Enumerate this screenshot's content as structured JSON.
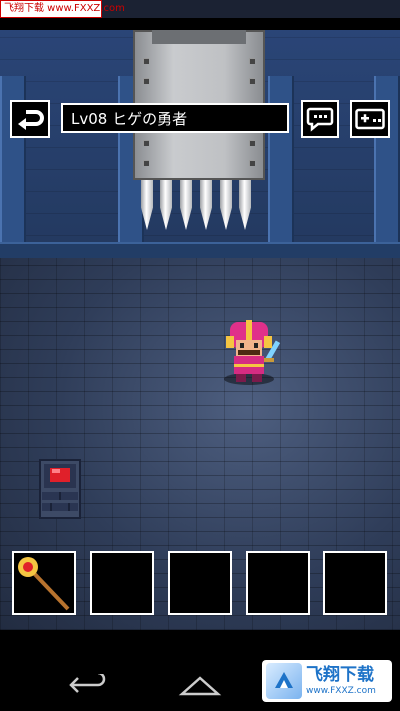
{
  "watermark_top": "飞翔下载 www.FXXZ.com",
  "hud": {
    "character_name": "Lv08 ヒゲの勇者"
  },
  "icons": {
    "back": "return-arrow-icon",
    "chat": "speech-bubble-icon",
    "controller": "gamepad-icon"
  },
  "inventory": {
    "slots": [
      {
        "item": "magic-staff"
      },
      {
        "item": ""
      },
      {
        "item": ""
      },
      {
        "item": ""
      },
      {
        "item": ""
      }
    ]
  },
  "watermark_bottom": {
    "title": "飞翔下载",
    "url": "www.FXXZ.com"
  },
  "colors": {
    "wall": "#2a4577",
    "floor": "#3a4866",
    "hero_helmet": "#e0308a",
    "switch": "#e0202a"
  }
}
